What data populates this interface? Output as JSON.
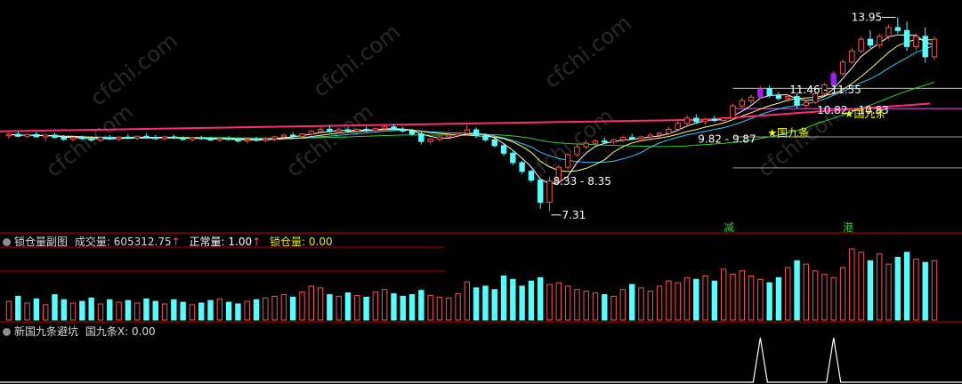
{
  "colors": {
    "background": "#000000",
    "up": "#ff5050",
    "down": "#54ffff",
    "ma_short": "#ffffff",
    "ma_mid": "#ffff66",
    "ma_long": "#33c8ff",
    "ma_green": "#33cc33",
    "ma_pink": "#ff2a7a",
    "signal": "#ffff00",
    "hline_white": "#c8c8c8",
    "hline_gray": "#a0a0a0",
    "hline_magenta": "#ff50ff",
    "hline_red": "#b00000",
    "divider": "#c80000",
    "signal_bar": "#a020ff",
    "vol_label": "#d8d8d8",
    "zero_label": "#e6e600"
  },
  "main_chart": {
    "price_annotations": [
      {
        "text": "13.95",
        "kind": "high"
      },
      {
        "text": "11.46 - 11.55",
        "kind": "range"
      },
      {
        "text": "10.82 - 10.83",
        "kind": "range"
      },
      {
        "text": "9.82 - 9.87",
        "kind": "range"
      },
      {
        "text": "8.33 - 8.35",
        "kind": "range"
      },
      {
        "text": "7.31",
        "kind": "low"
      }
    ],
    "signals": [
      {
        "text": "★国九条"
      },
      {
        "text": "★国九条"
      }
    ],
    "markers": [
      {
        "text": "减"
      },
      {
        "text": "港"
      }
    ],
    "watermark": "cfchi.com"
  },
  "volume_panel": {
    "name": "锁仓量副图",
    "items": [
      {
        "label": "成交量",
        "value": "605312.75",
        "arrow": "↑"
      },
      {
        "label": "正常量",
        "value": "1.00",
        "arrow": "↑"
      },
      {
        "label": "锁仓量",
        "value": "0.00",
        "arrow": ""
      }
    ]
  },
  "signal_panel": {
    "name": "新国九条避坑",
    "label": "国九条X",
    "value": "0.00"
  },
  "chart_data": {
    "type": "candlestick",
    "ylim": [
      7.0,
      14.3
    ],
    "candles": [
      {
        "o": 9.9,
        "h": 10.0,
        "l": 9.8,
        "c": 9.95
      },
      {
        "o": 9.95,
        "h": 10.05,
        "l": 9.85,
        "c": 9.88
      },
      {
        "o": 9.88,
        "h": 9.98,
        "l": 9.82,
        "c": 9.94
      },
      {
        "o": 9.94,
        "h": 10.03,
        "l": 9.88,
        "c": 9.86
      },
      {
        "o": 9.86,
        "h": 9.96,
        "l": 9.7,
        "c": 9.92
      },
      {
        "o": 9.92,
        "h": 10.0,
        "l": 9.8,
        "c": 9.84
      },
      {
        "o": 9.84,
        "h": 9.92,
        "l": 9.72,
        "c": 9.78
      },
      {
        "o": 9.78,
        "h": 9.86,
        "l": 9.7,
        "c": 9.84
      },
      {
        "o": 9.84,
        "h": 9.9,
        "l": 9.74,
        "c": 9.8
      },
      {
        "o": 9.8,
        "h": 9.88,
        "l": 9.7,
        "c": 9.75
      },
      {
        "o": 9.75,
        "h": 9.86,
        "l": 9.68,
        "c": 9.83
      },
      {
        "o": 9.83,
        "h": 9.92,
        "l": 9.75,
        "c": 9.79
      },
      {
        "o": 9.79,
        "h": 9.88,
        "l": 9.72,
        "c": 9.85
      },
      {
        "o": 9.85,
        "h": 9.95,
        "l": 9.78,
        "c": 9.82
      },
      {
        "o": 9.82,
        "h": 9.9,
        "l": 9.74,
        "c": 9.88
      },
      {
        "o": 9.88,
        "h": 9.98,
        "l": 9.8,
        "c": 9.84
      },
      {
        "o": 9.84,
        "h": 9.92,
        "l": 9.76,
        "c": 9.8
      },
      {
        "o": 9.8,
        "h": 9.9,
        "l": 9.72,
        "c": 9.86
      },
      {
        "o": 9.86,
        "h": 9.94,
        "l": 9.78,
        "c": 9.82
      },
      {
        "o": 9.82,
        "h": 9.88,
        "l": 9.74,
        "c": 9.77
      },
      {
        "o": 9.77,
        "h": 9.86,
        "l": 9.7,
        "c": 9.83
      },
      {
        "o": 9.83,
        "h": 9.9,
        "l": 9.76,
        "c": 9.8
      },
      {
        "o": 9.8,
        "h": 9.86,
        "l": 9.72,
        "c": 9.75
      },
      {
        "o": 9.75,
        "h": 9.84,
        "l": 9.68,
        "c": 9.8
      },
      {
        "o": 9.8,
        "h": 9.88,
        "l": 9.74,
        "c": 9.78
      },
      {
        "o": 9.78,
        "h": 9.84,
        "l": 9.66,
        "c": 9.72
      },
      {
        "o": 9.72,
        "h": 9.8,
        "l": 9.64,
        "c": 9.77
      },
      {
        "o": 9.77,
        "h": 9.86,
        "l": 9.7,
        "c": 9.74
      },
      {
        "o": 9.74,
        "h": 9.82,
        "l": 9.68,
        "c": 9.79
      },
      {
        "o": 9.79,
        "h": 9.9,
        "l": 9.72,
        "c": 9.86
      },
      {
        "o": 9.86,
        "h": 9.96,
        "l": 9.8,
        "c": 9.92
      },
      {
        "o": 9.92,
        "h": 10.02,
        "l": 9.84,
        "c": 9.88
      },
      {
        "o": 9.88,
        "h": 9.98,
        "l": 9.8,
        "c": 9.96
      },
      {
        "o": 9.96,
        "h": 10.1,
        "l": 9.9,
        "c": 10.05
      },
      {
        "o": 10.05,
        "h": 10.2,
        "l": 9.98,
        "c": 10.12
      },
      {
        "o": 10.12,
        "h": 10.25,
        "l": 10.0,
        "c": 10.04
      },
      {
        "o": 10.04,
        "h": 10.15,
        "l": 9.96,
        "c": 10.1
      },
      {
        "o": 10.1,
        "h": 10.2,
        "l": 10.0,
        "c": 10.06
      },
      {
        "o": 10.06,
        "h": 10.15,
        "l": 9.98,
        "c": 10.12
      },
      {
        "o": 10.12,
        "h": 10.22,
        "l": 10.02,
        "c": 10.08
      },
      {
        "o": 10.08,
        "h": 10.18,
        "l": 9.98,
        "c": 10.14
      },
      {
        "o": 10.14,
        "h": 10.25,
        "l": 10.05,
        "c": 10.2
      },
      {
        "o": 10.2,
        "h": 10.3,
        "l": 10.08,
        "c": 10.12
      },
      {
        "o": 10.12,
        "h": 10.2,
        "l": 10.0,
        "c": 10.06
      },
      {
        "o": 10.06,
        "h": 10.14,
        "l": 9.9,
        "c": 9.96
      },
      {
        "o": 9.96,
        "h": 10.04,
        "l": 9.6,
        "c": 9.7
      },
      {
        "o": 9.7,
        "h": 9.82,
        "l": 9.6,
        "c": 9.78
      },
      {
        "o": 9.78,
        "h": 9.9,
        "l": 9.7,
        "c": 9.86
      },
      {
        "o": 9.86,
        "h": 9.98,
        "l": 9.78,
        "c": 9.92
      },
      {
        "o": 9.92,
        "h": 10.02,
        "l": 9.84,
        "c": 9.98
      },
      {
        "o": 9.98,
        "h": 10.28,
        "l": 9.9,
        "c": 10.1
      },
      {
        "o": 10.1,
        "h": 10.18,
        "l": 9.82,
        "c": 9.9
      },
      {
        "o": 9.9,
        "h": 9.98,
        "l": 9.7,
        "c": 9.76
      },
      {
        "o": 9.76,
        "h": 9.82,
        "l": 9.5,
        "c": 9.56
      },
      {
        "o": 9.56,
        "h": 9.62,
        "l": 9.2,
        "c": 9.3
      },
      {
        "o": 9.3,
        "h": 9.36,
        "l": 8.9,
        "c": 8.98
      },
      {
        "o": 8.98,
        "h": 9.04,
        "l": 8.6,
        "c": 8.68
      },
      {
        "o": 8.68,
        "h": 8.74,
        "l": 8.3,
        "c": 8.38
      },
      {
        "o": 8.38,
        "h": 8.44,
        "l": 7.4,
        "c": 7.62
      },
      {
        "o": 7.62,
        "h": 8.5,
        "l": 7.31,
        "c": 8.35
      },
      {
        "o": 8.35,
        "h": 8.9,
        "l": 8.33,
        "c": 8.82
      },
      {
        "o": 8.82,
        "h": 9.3,
        "l": 8.76,
        "c": 9.25
      },
      {
        "o": 9.25,
        "h": 9.6,
        "l": 9.18,
        "c": 9.52
      },
      {
        "o": 9.52,
        "h": 9.72,
        "l": 9.44,
        "c": 9.64
      },
      {
        "o": 9.64,
        "h": 9.78,
        "l": 9.56,
        "c": 9.72
      },
      {
        "o": 9.72,
        "h": 9.84,
        "l": 9.64,
        "c": 9.68
      },
      {
        "o": 9.68,
        "h": 9.8,
        "l": 9.6,
        "c": 9.76
      },
      {
        "o": 9.76,
        "h": 9.9,
        "l": 9.68,
        "c": 9.84
      },
      {
        "o": 9.84,
        "h": 9.96,
        "l": 9.76,
        "c": 9.8
      },
      {
        "o": 9.8,
        "h": 9.9,
        "l": 9.7,
        "c": 9.86
      },
      {
        "o": 9.86,
        "h": 9.98,
        "l": 9.8,
        "c": 9.92
      },
      {
        "o": 9.92,
        "h": 10.04,
        "l": 9.84,
        "c": 9.98
      },
      {
        "o": 9.98,
        "h": 10.2,
        "l": 9.92,
        "c": 10.12
      },
      {
        "o": 10.12,
        "h": 10.4,
        "l": 10.04,
        "c": 10.32
      },
      {
        "o": 10.32,
        "h": 10.6,
        "l": 10.24,
        "c": 10.5
      },
      {
        "o": 10.5,
        "h": 10.64,
        "l": 10.3,
        "c": 10.38
      },
      {
        "o": 10.38,
        "h": 10.52,
        "l": 10.28,
        "c": 10.46
      },
      {
        "o": 10.46,
        "h": 10.58,
        "l": 10.36,
        "c": 10.42
      },
      {
        "o": 10.42,
        "h": 10.56,
        "l": 10.32,
        "c": 10.5
      },
      {
        "o": 10.5,
        "h": 11.0,
        "l": 10.44,
        "c": 10.92
      },
      {
        "o": 10.92,
        "h": 11.2,
        "l": 10.86,
        "c": 11.1
      },
      {
        "o": 11.1,
        "h": 11.3,
        "l": 11.0,
        "c": 11.22
      },
      {
        "o": 11.22,
        "h": 11.6,
        "l": 11.16,
        "c": 11.5
      },
      {
        "o": 11.5,
        "h": 11.62,
        "l": 11.2,
        "c": 11.28
      },
      {
        "o": 11.28,
        "h": 11.4,
        "l": 11.1,
        "c": 11.18
      },
      {
        "o": 11.18,
        "h": 11.3,
        "l": 11.04,
        "c": 11.24
      },
      {
        "o": 11.24,
        "h": 11.36,
        "l": 10.82,
        "c": 10.94
      },
      {
        "o": 10.94,
        "h": 11.1,
        "l": 10.83,
        "c": 11.04
      },
      {
        "o": 11.04,
        "h": 11.4,
        "l": 10.98,
        "c": 11.34
      },
      {
        "o": 11.34,
        "h": 11.7,
        "l": 11.28,
        "c": 11.64
      },
      {
        "o": 11.64,
        "h": 12.1,
        "l": 11.58,
        "c": 12.02
      },
      {
        "o": 12.02,
        "h": 12.5,
        "l": 11.96,
        "c": 12.42
      },
      {
        "o": 12.42,
        "h": 12.9,
        "l": 12.36,
        "c": 12.8
      },
      {
        "o": 12.8,
        "h": 13.3,
        "l": 12.72,
        "c": 13.2
      },
      {
        "o": 13.2,
        "h": 13.5,
        "l": 12.9,
        "c": 13.0
      },
      {
        "o": 13.0,
        "h": 13.4,
        "l": 12.9,
        "c": 13.3
      },
      {
        "o": 13.3,
        "h": 13.7,
        "l": 13.2,
        "c": 13.6
      },
      {
        "o": 13.6,
        "h": 13.95,
        "l": 13.4,
        "c": 13.5
      },
      {
        "o": 13.5,
        "h": 13.8,
        "l": 12.8,
        "c": 12.95
      },
      {
        "o": 12.95,
        "h": 13.4,
        "l": 12.8,
        "c": 13.3
      },
      {
        "o": 13.3,
        "h": 13.6,
        "l": 12.4,
        "c": 12.6
      },
      {
        "o": 12.6,
        "h": 13.3,
        "l": 12.5,
        "c": 13.2
      }
    ],
    "volume": [
      22,
      28,
      20,
      25,
      18,
      30,
      24,
      20,
      22,
      26,
      19,
      24,
      21,
      23,
      20,
      25,
      22,
      19,
      24,
      21,
      18,
      20,
      23,
      25,
      21,
      19,
      22,
      24,
      26,
      28,
      30,
      27,
      33,
      40,
      38,
      30,
      28,
      32,
      29,
      27,
      33,
      36,
      31,
      28,
      30,
      35,
      29,
      27,
      26,
      31,
      45,
      38,
      40,
      36,
      52,
      48,
      40,
      46,
      50,
      42,
      44,
      40,
      36,
      34,
      32,
      30,
      28,
      36,
      42,
      38,
      34,
      40,
      46,
      44,
      50,
      48,
      52,
      46,
      60,
      54,
      58,
      52,
      48,
      44,
      50,
      62,
      70,
      66,
      58,
      54,
      50,
      62,
      84,
      80,
      70,
      78,
      66,
      74,
      80,
      72,
      68,
      70
    ],
    "signal": {
      "value": 0,
      "spikes": [
        82,
        90
      ]
    },
    "levels": [
      13.95,
      11.55,
      11.46,
      10.83,
      10.82,
      9.87,
      9.82,
      8.35,
      8.33,
      7.31
    ]
  }
}
